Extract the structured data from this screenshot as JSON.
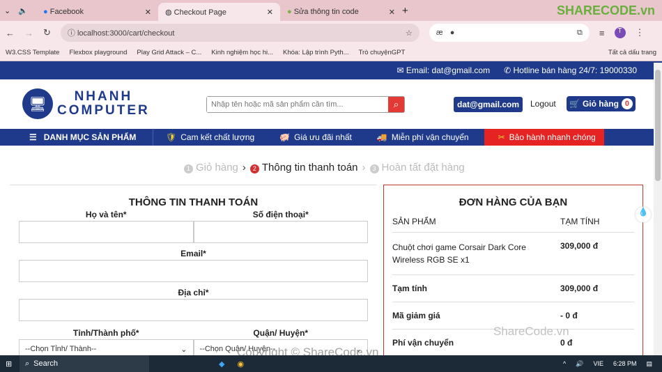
{
  "browser": {
    "tabs": [
      {
        "title": "Facebook",
        "icon": "facebook-icon"
      },
      {
        "title": "Checkout Page",
        "icon": "globe-icon"
      },
      {
        "title": "Sửa thông tin code",
        "icon": "leaf-icon"
      }
    ],
    "url": "localhost:3000/cart/checkout",
    "bookmarks": [
      "W3.CSS Template",
      "Flexbox playground",
      "Play Grid Attack – C...",
      "Kinh nghiệm học hi...",
      "Khóa: Lập trình Pyth...",
      "Trò chuyệnGPT"
    ],
    "all_bookmarks": "Tất cả dấu trang",
    "profile": "T"
  },
  "topbar": {
    "email": "Email: dat@gmail.com",
    "hotline": "Hotline bán hàng 24/7: 19000330"
  },
  "header": {
    "logo_line1": "NHANH",
    "logo_line2": "COMPUTER",
    "search_placeholder": "Nhập tên hoặc mã sản phẩm cần tìm...",
    "user": "dat@gmail.com",
    "logout": "Logout",
    "cart_label": "Giỏ hàng",
    "cart_count": "0"
  },
  "nav": {
    "menu": "DANH MỤC SẢN PHẨM",
    "items": [
      "Cam kết chất lượng",
      "Giá ưu đãi nhất",
      "Miễn phí vận chuyển",
      "Bảo hành nhanh chóng"
    ]
  },
  "steps": [
    {
      "n": "1",
      "label": "Giỏ hàng"
    },
    {
      "n": "2",
      "label": "Thông tin thanh toán"
    },
    {
      "n": "3",
      "label": "Hoàn tất đặt hàng"
    }
  ],
  "billing": {
    "title": "THÔNG TIN THANH TOÁN",
    "name": "Họ và tên*",
    "phone": "Số điện thoại*",
    "email": "Email*",
    "address": "Địa chỉ*",
    "province": "Tỉnh/Thành phố*",
    "district": "Quận/ Huyện*",
    "province_select": "--Chọn Tỉnh/ Thành--",
    "district_select": "--Chọn Quận/ Huyện--"
  },
  "order": {
    "title": "ĐƠN HÀNG CỦA BẠN",
    "col_product": "SẢN PHẨM",
    "col_subtotal": "TẠM TÍNH",
    "product_name": "Chuột chơi game Corsair Dark Core Wireless RGB SE x1",
    "product_price": "309,000 đ",
    "rows": [
      {
        "label": "Tạm tính",
        "value": "309,000 đ"
      },
      {
        "label": "Mã giảm giá",
        "value": "- 0 đ"
      },
      {
        "label": "Phí vận chuyển",
        "value": "0 đ"
      }
    ]
  },
  "watermarks": {
    "logo": "SHARECODE.vn",
    "mid": "ShareCode.vn",
    "bottom": "Copyright © ShareCode.vn"
  },
  "taskbar": {
    "search": "Search",
    "lang": "VIE",
    "time": "6:28 PM"
  }
}
